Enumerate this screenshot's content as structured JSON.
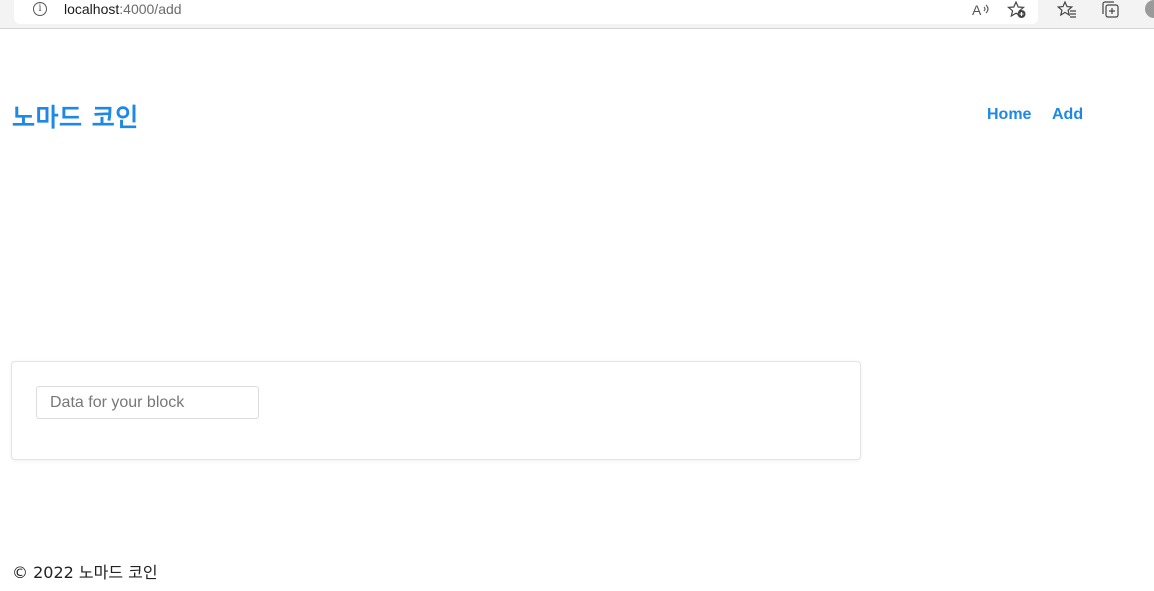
{
  "browser": {
    "url_host": "localhost",
    "url_path": ":4000/add",
    "icons": [
      "info-icon",
      "read-aloud-icon",
      "favorite-add-icon",
      "favorites-icon",
      "collections-icon",
      "profile-icon"
    ]
  },
  "header": {
    "title": "노마드 코인",
    "nav": [
      {
        "label": "Home"
      },
      {
        "label": "Add"
      }
    ]
  },
  "form": {
    "data_input": {
      "value": "",
      "placeholder": "Data for your block"
    }
  },
  "footer": {
    "text": "© 2022 노마드 코인"
  },
  "colors": {
    "accent": "#1e88e5",
    "text": "#222222",
    "border": "#e4e4e4"
  }
}
